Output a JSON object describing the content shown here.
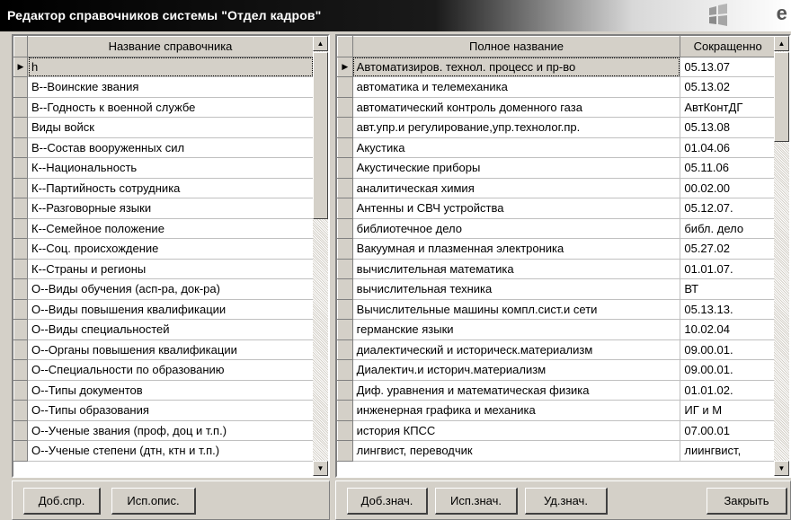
{
  "window": {
    "title": "Редактор справочников системы \"Отдел кадров\""
  },
  "left_grid": {
    "header": "Название справочника",
    "rows": [
      "h",
      "В--Воинские звания",
      "В--Годность к военной службе",
      "Виды войск",
      "В--Состав вооруженных сил",
      "К--Национальность",
      "К--Партийность сотрудника",
      "К--Разговорные языки",
      "К--Семейное положение",
      "К--Соц. происхождение",
      "К--Страны и регионы",
      "О--Виды обучения (асп-ра, док-ра)",
      "О--Виды повышения квалификации",
      "О--Виды специальностей",
      "О--Органы повышения квалификации",
      "О--Специальности по образованию",
      "О--Типы документов",
      "О--Типы образования",
      "О--Ученые звания (проф, доц и т.п.)",
      "О--Ученые степени (дтн, ктн и т.п.)"
    ],
    "selected_index": 0
  },
  "right_grid": {
    "headers": [
      "Полное название",
      "Сокращенно"
    ],
    "rows": [
      [
        "Автоматизиров. технол. процесс и пр-во",
        "05.13.07"
      ],
      [
        "автоматика и телемеханика",
        "05.13.02"
      ],
      [
        "автоматический контроль доменного газа",
        "АвтКонтДГ"
      ],
      [
        "авт.упр.и регулирование,упр.технолог.пр.",
        "05.13.08"
      ],
      [
        "Акустика",
        "01.04.06"
      ],
      [
        "Акустические приборы",
        "05.11.06"
      ],
      [
        "аналитическая химия",
        "00.02.00"
      ],
      [
        "Антенны и СВЧ устройства",
        "05.12.07."
      ],
      [
        "библиотечное дело",
        "библ. дело"
      ],
      [
        "Вакуумная и плазменная электроника",
        "05.27.02"
      ],
      [
        "вычислительная математика",
        "01.01.07."
      ],
      [
        "вычислительная техника",
        "ВТ"
      ],
      [
        "Вычислительные машины компл.сист.и сети",
        "05.13.13."
      ],
      [
        "германские языки",
        "10.02.04"
      ],
      [
        "диалектический и историческ.материализм",
        "09.00.01."
      ],
      [
        "Диалектич.и историч.материализм",
        "09.00.01."
      ],
      [
        "Диф. уравнения и математическая физика",
        "01.01.02."
      ],
      [
        "инженерная графика и механика",
        "ИГ и М"
      ],
      [
        "история КПСС",
        "07.00.01"
      ],
      [
        "лингвист, переводчик",
        "лиингвист,"
      ]
    ],
    "selected_index": 0
  },
  "left_buttons": {
    "add_dict": "Доб.спр.",
    "edit_desc": "Исп.опис."
  },
  "right_buttons": {
    "add_value": "Доб.знач.",
    "edit_value": "Исп.знач.",
    "delete_value": "Уд.знач.",
    "close": "Закрыть"
  },
  "colors": {
    "window_bg": "#d4d0c8",
    "title_bg": "#000000",
    "title_text": "#ffffff",
    "grid_bg": "#ffffff"
  }
}
